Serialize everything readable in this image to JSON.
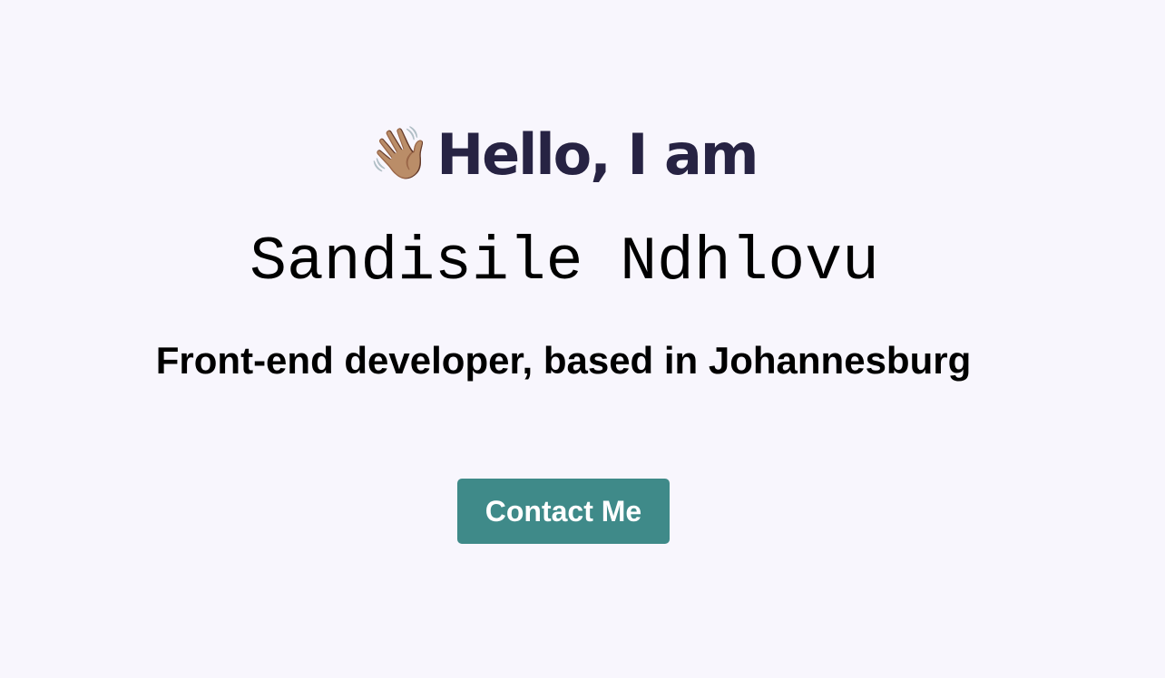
{
  "hero": {
    "wave_emoji": "👋🏽",
    "greeting": "Hello, I am",
    "name": "Sandisile Ndhlovu",
    "tagline": "Front-end developer, based in Johannesburg",
    "contact_label": "Contact Me"
  },
  "colors": {
    "background": "#f8f6fd",
    "heading": "#272343",
    "text": "#000000",
    "button": "#3f8a89",
    "button_text": "#ffffff"
  }
}
